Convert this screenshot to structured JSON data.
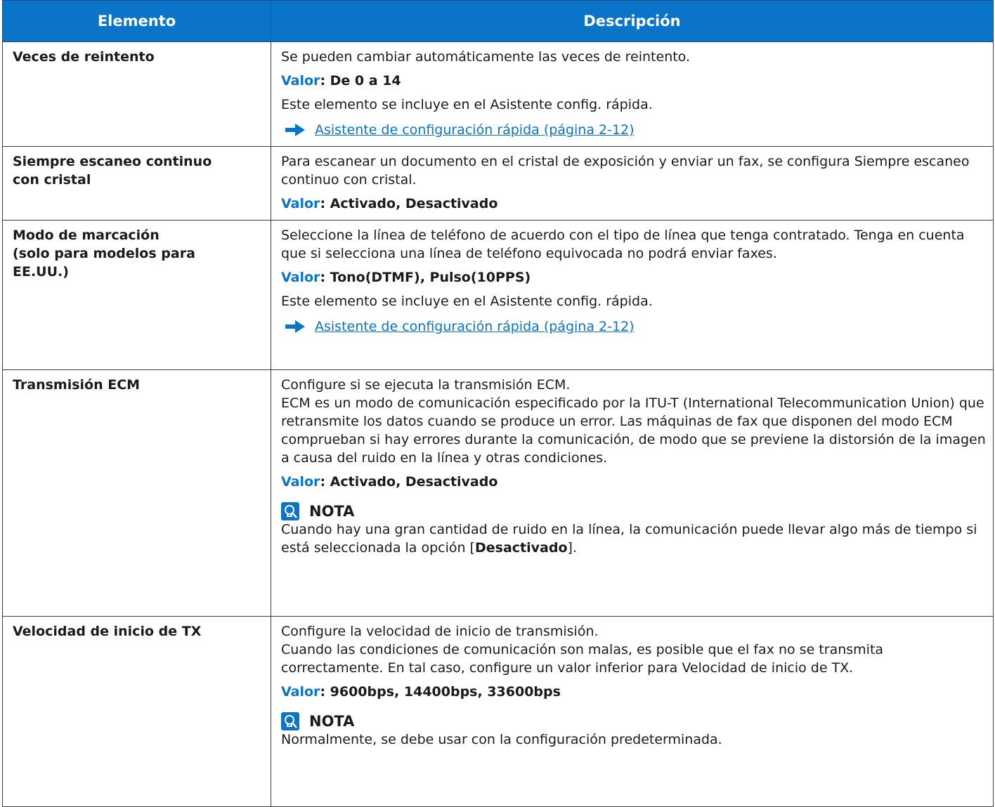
{
  "header": {
    "col_item": "Elemento",
    "col_desc": "Descripción"
  },
  "value_label": "Valor",
  "rows": [
    {
      "item": "Veces de reintento",
      "p1": "Se pueden cambiar automáticamente las veces de reintento.",
      "value": ": De 0 a 14",
      "p2": "Este elemento se incluye en el Asistente config. rápida.",
      "link": "Asistente de configuración rápida (página 2-12)"
    },
    {
      "item_l1": "Siempre escaneo continuo",
      "item_l2": "con cristal",
      "p1": "Para escanear un documento en el cristal de exposición y enviar un fax, se configura Siempre escaneo continuo con cristal.",
      "value": ": Activado, Desactivado"
    },
    {
      "item_l1": "Modo de marcación",
      "item_l2": "(solo para modelos para",
      "item_l3": "EE.UU.)",
      "p1": "Seleccione la línea de teléfono de acuerdo con el tipo de línea que tenga contratado. Tenga en cuenta que si selecciona una línea de teléfono equivocada no podrá enviar faxes.",
      "value": ": Tono(DTMF), Pulso(10PPS)",
      "p2": "Este elemento se incluye en el Asistente config. rápida.",
      "link": "Asistente de configuración rápida (página 2-12)"
    },
    {
      "item": "Transmisión ECM",
      "p1": "Configure si se ejecuta la transmisión ECM.",
      "p2": "ECM es un modo de comunicación especificado por la ITU-T (International Telecommunication Union) que retransmite los datos cuando se produce un error. Las máquinas de fax que disponen del modo ECM comprueban si hay errores durante la comunicación, de modo que se previene la distorsión de la imagen a causa del ruido en la línea y otras condiciones.",
      "value": ": Activado, Desactivado",
      "note_title": "NOTA",
      "note_pre": "Cuando hay una gran cantidad de ruido en la línea, la comunicación puede llevar algo más de tiempo si está seleccionada la opción [",
      "note_bold": "Desactivado",
      "note_post": "]."
    },
    {
      "item": "Velocidad de inicio de TX",
      "p1": "Configure la velocidad de inicio de transmisión.",
      "p2": "Cuando las condiciones de comunicación son malas, es posible que el fax no se transmita correctamente. En tal caso, configure un valor inferior para Velocidad de inicio de TX.",
      "value": ": 9600bps, 14400bps, 33600bps",
      "note_title": "NOTA",
      "note_text": "Normalmente, se debe usar con la configuración predeterminada."
    }
  ]
}
